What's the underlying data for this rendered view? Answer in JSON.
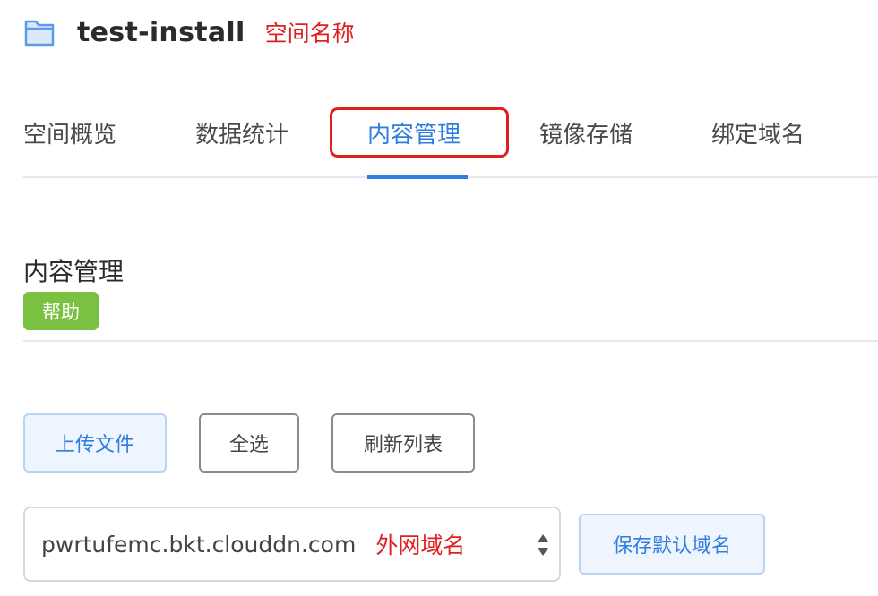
{
  "header": {
    "icon": "folder-icon",
    "title": "test-install",
    "annotation": "空间名称"
  },
  "tabs": [
    {
      "label": "空间概览",
      "active": false
    },
    {
      "label": "数据统计",
      "active": false
    },
    {
      "label": "内容管理",
      "active": true
    },
    {
      "label": "镜像存储",
      "active": false
    },
    {
      "label": "绑定域名",
      "active": false
    }
  ],
  "section": {
    "title": "内容管理",
    "help_label": "帮助"
  },
  "toolbar": {
    "upload_label": "上传文件",
    "select_all_label": "全选",
    "refresh_label": "刷新列表"
  },
  "domain": {
    "selected_value": "pwrtufemc.bkt.clouddn.com",
    "annotation": "外网域名",
    "save_label": "保存默认域名",
    "arrows_icon": "select-arrows-icon"
  },
  "colors": {
    "accent": "#2f7de1",
    "annotation_red": "#e02020",
    "help_green": "#7ac142"
  }
}
